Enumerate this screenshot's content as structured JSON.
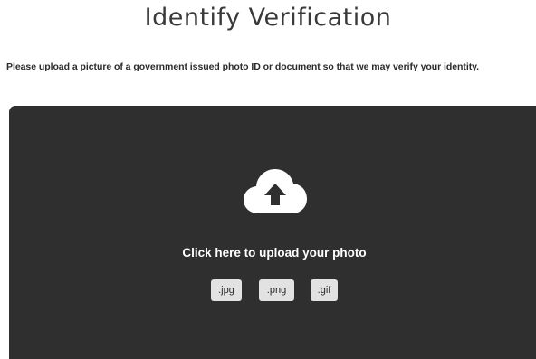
{
  "page": {
    "title": "Identify Verification",
    "instructions": "Please upload a picture of a government issued photo ID or document so that we may verify your identity."
  },
  "upload": {
    "label": "Click here to upload your photo",
    "icon": "cloud-upload-icon",
    "formats": [
      ".jpg",
      ".png",
      ".gif"
    ]
  },
  "colors": {
    "dropzone_bg": "#2f2f2f",
    "badge_bg": "#e2e2e2",
    "title_text": "#3a3a3a"
  }
}
